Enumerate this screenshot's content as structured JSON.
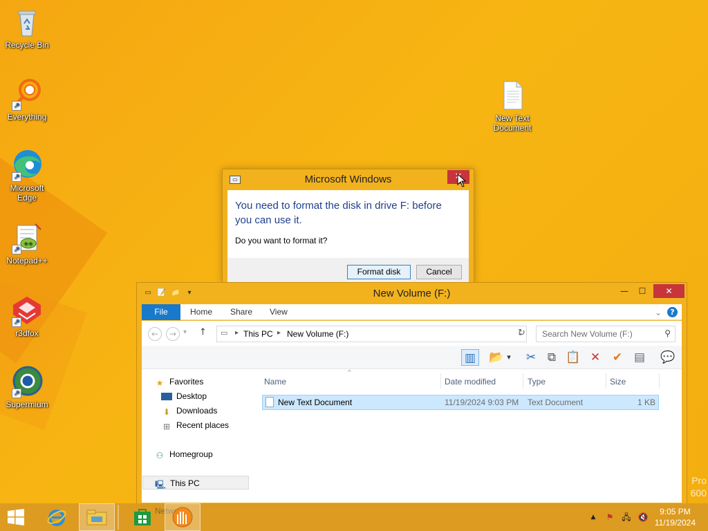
{
  "desktop": {
    "icons": [
      {
        "label": "Recycle Bin"
      },
      {
        "label": "Everything"
      },
      {
        "label": "Microsoft Edge"
      },
      {
        "label": "Notepad++"
      },
      {
        "label": "r3dfox"
      },
      {
        "label": "Supermium"
      },
      {
        "label": "New Text Document"
      }
    ],
    "watermark_line1": "Pro",
    "watermark_line2": "600"
  },
  "dialog": {
    "title": "Microsoft Windows",
    "message": "You need to format the disk in drive F: before you can use it.",
    "question": "Do you want to format it?",
    "format_button": "Format disk",
    "cancel_button": "Cancel"
  },
  "explorer": {
    "title": "New Volume (F:)",
    "ribbon_tabs": [
      "File",
      "Home",
      "Share",
      "View"
    ],
    "breadcrumb": [
      "This PC",
      "New Volume (F:)"
    ],
    "search_placeholder": "Search New Volume (F:)",
    "nav": {
      "favorites": "Favorites",
      "desktop": "Desktop",
      "downloads": "Downloads",
      "recent": "Recent places",
      "homegroup": "Homegroup",
      "this_pc": "This PC"
    },
    "columns": [
      "Name",
      "Date modified",
      "Type",
      "Size"
    ],
    "files": [
      {
        "name": "New Text Document",
        "date": "11/19/2024 9:03 PM",
        "type": "Text Document",
        "size": "1 KB"
      }
    ]
  },
  "taskbar": {
    "hidden_label": "Network",
    "time": "9:05 PM",
    "date": "11/19/2024"
  },
  "colors": {
    "desktop_bg": "#f5a711",
    "window_frame": "#f2b21e",
    "close_red": "#c7343a",
    "file_tab": "#1979ca",
    "dialog_text": "#1f3f8a",
    "selection": "#cce8ff"
  }
}
